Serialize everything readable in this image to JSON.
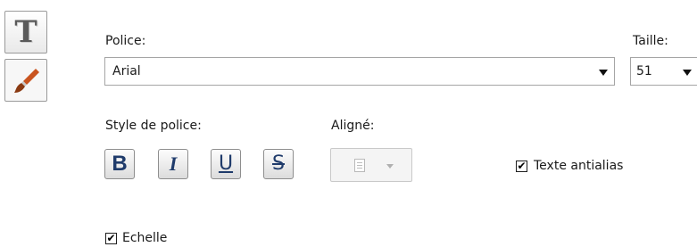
{
  "font": {
    "label": "Police:",
    "value": "Arial"
  },
  "size": {
    "label": "Taille:",
    "value": "51"
  },
  "style": {
    "label": "Style de police:",
    "bold": "B",
    "italic": "I",
    "underline": "U",
    "strike": "S"
  },
  "align": {
    "label": "Aligné:"
  },
  "antialias": {
    "label": "Texte antialias",
    "checked": true,
    "mark": "✔"
  },
  "scale": {
    "label": "Echelle",
    "checked": true,
    "mark": "✔"
  },
  "icons": {
    "text_tool": "T",
    "brush_tool": "brush-icon"
  },
  "colors": {
    "button_text": "#1f3b6b",
    "border": "#a5a5a5"
  }
}
